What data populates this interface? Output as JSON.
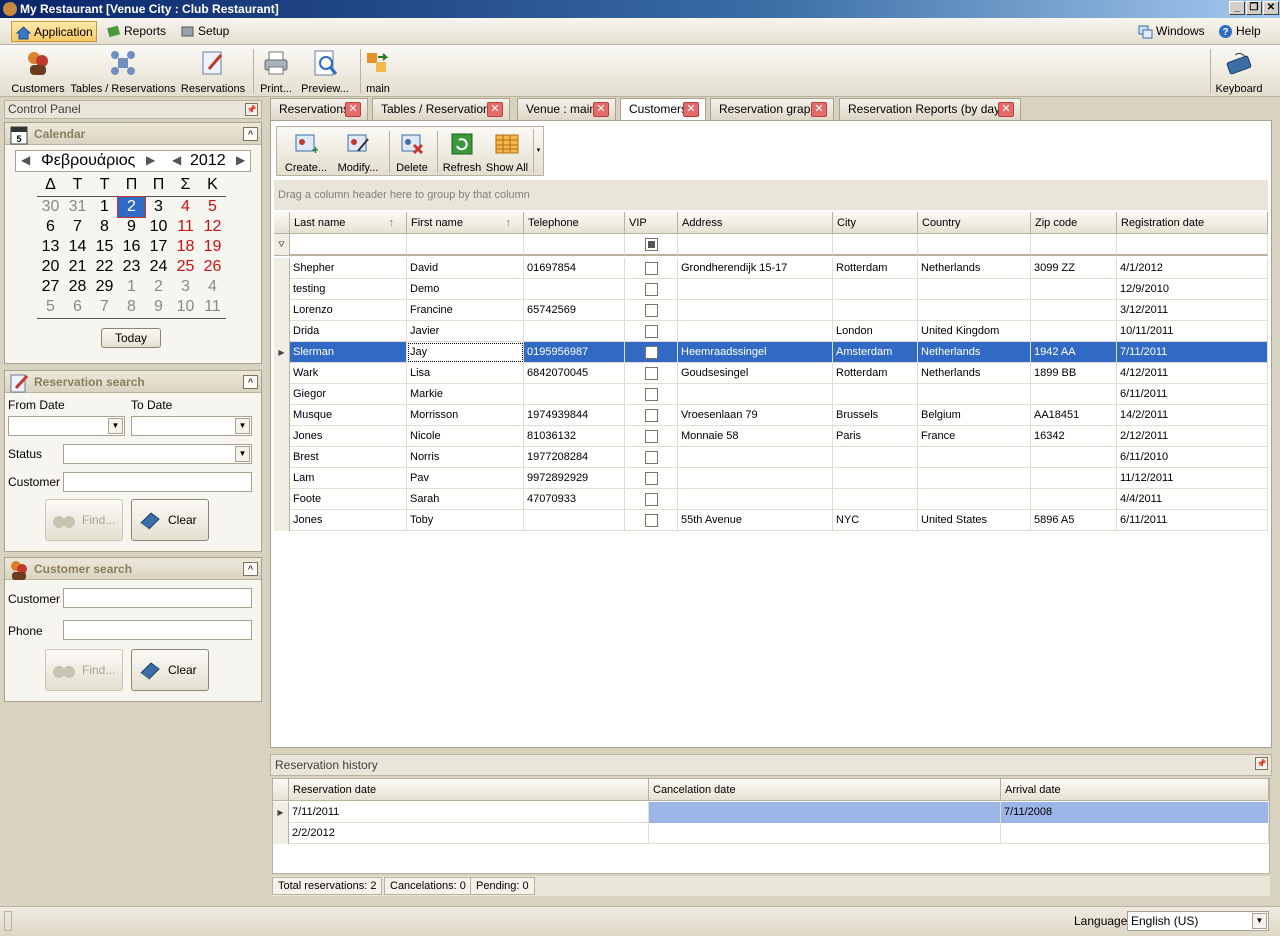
{
  "window": {
    "title": "My Restaurant [Venue City : Club Restaurant]"
  },
  "menu": {
    "left": [
      {
        "label": "Application",
        "icon": "home-icon"
      },
      {
        "label": "Reports",
        "icon": "reports-icon"
      },
      {
        "label": "Setup",
        "icon": "setup-icon"
      }
    ],
    "right": [
      {
        "label": "Windows",
        "icon": "windows-icon"
      },
      {
        "label": "Help",
        "icon": "help-icon"
      }
    ]
  },
  "toolbar": {
    "buttons": [
      "Customers",
      "Tables / Reservations",
      "Reservations",
      "Print...",
      "Preview...",
      "main"
    ],
    "keyboard": "Keyboard"
  },
  "control_panel": {
    "title": "Control Panel"
  },
  "calendar": {
    "title": "Calendar",
    "month": "Φεβρουάριος",
    "year": "2012",
    "weekdays": [
      "Δ",
      "Τ",
      "Τ",
      "Π",
      "Π",
      "Σ",
      "Κ"
    ],
    "weeks": [
      [
        "30",
        "31",
        "1",
        "2",
        "3",
        "4",
        "5"
      ],
      [
        "6",
        "7",
        "8",
        "9",
        "10",
        "11",
        "12"
      ],
      [
        "13",
        "14",
        "15",
        "16",
        "17",
        "18",
        "19"
      ],
      [
        "20",
        "21",
        "22",
        "23",
        "24",
        "25",
        "26"
      ],
      [
        "27",
        "28",
        "29",
        "1",
        "2",
        "3",
        "4"
      ],
      [
        "5",
        "6",
        "7",
        "8",
        "9",
        "10",
        "11"
      ]
    ],
    "selected_day": "2",
    "today_label": "Today",
    "colors": {
      "other_month": "#8a8a8a",
      "weekend": "#cc1111",
      "selected_bg": "#316ac5"
    }
  },
  "reservation_search": {
    "title": "Reservation search",
    "from_date_label": "From Date",
    "to_date_label": "To Date",
    "status_label": "Status",
    "customer_label": "Customer",
    "find_label": "Find...",
    "clear_label": "Clear"
  },
  "customer_search": {
    "title": "Customer search",
    "customer_label": "Customer",
    "phone_label": "Phone",
    "find_label": "Find...",
    "clear_label": "Clear"
  },
  "tabs": [
    {
      "label": "Reservations",
      "active": false
    },
    {
      "label": "Tables / Reservations",
      "active": false
    },
    {
      "label": "Venue : main",
      "active": false
    },
    {
      "label": "Customers",
      "active": true
    },
    {
      "label": "Reservation graph",
      "active": false
    },
    {
      "label": "Reservation Reports (by day)",
      "active": false
    }
  ],
  "grid_toolbar": [
    "Create...",
    "Modify...",
    "Delete",
    "Refresh",
    "Show All"
  ],
  "group_hint": "Drag a column header here to group by that column",
  "customers": {
    "columns": [
      "Last name",
      "First name",
      "Telephone",
      "VIP",
      "Address",
      "City",
      "Country",
      "Zip code",
      "Registration date"
    ],
    "rows": [
      [
        "Shepher",
        "David",
        "01697854",
        "",
        "Grondherendijk 15-17",
        "Rotterdam",
        "Netherlands",
        "3099 ZZ",
        "4/1/2012"
      ],
      [
        "testing",
        "Demo",
        "",
        "",
        "",
        "",
        "",
        "",
        "12/9/2010"
      ],
      [
        "Lorenzo",
        "Francine",
        "65742569",
        "",
        "",
        "",
        "",
        "",
        "3/12/2011"
      ],
      [
        "Drida",
        "Javier",
        "",
        "",
        "",
        "London",
        "United Kingdom",
        "",
        "10/11/2011"
      ],
      [
        "Slerman",
        "Jay",
        "0195956987",
        "",
        "Heemraadssingel",
        "Amsterdam",
        "Netherlands",
        "1942 AA",
        "7/11/2011"
      ],
      [
        "Wark",
        "Lisa",
        "6842070045",
        "",
        "Goudsesingel",
        "Rotterdam",
        "Netherlands",
        "1899 BB",
        "4/12/2011"
      ],
      [
        "Giegor",
        "Markie",
        "",
        "",
        "",
        "",
        "",
        "",
        "6/11/2011"
      ],
      [
        "Musque",
        "Morrisson",
        "1974939844",
        "",
        "Vroesenlaan  79",
        "Brussels",
        "Belgium",
        "AA18451",
        "14/2/2011"
      ],
      [
        "Jones",
        "Nicole",
        "81036132",
        "",
        "Monnaie 58",
        "Paris",
        "France",
        "16342",
        "2/12/2011"
      ],
      [
        "Brest",
        "Norris",
        "1977208284",
        "",
        "",
        "",
        "",
        "",
        "6/11/2010"
      ],
      [
        "Lam",
        "Pav",
        "9972892929",
        "",
        "",
        "",
        "",
        "",
        "11/12/2011"
      ],
      [
        "Foote",
        "Sarah",
        "47070933",
        "",
        "",
        "",
        "",
        "",
        "4/4/2011"
      ],
      [
        "Jones",
        "Toby",
        "",
        "",
        "55th Avenue",
        "NYC",
        "United States",
        "5896 A5",
        "6/11/2011"
      ]
    ],
    "selected_row": 4
  },
  "reservation_history": {
    "title": "Reservation history",
    "columns": [
      "Reservation date",
      "Cancelation date",
      "Arrival date"
    ],
    "rows": [
      [
        "7/11/2011",
        "",
        "7/11/2008"
      ],
      [
        "2/2/2012",
        "",
        ""
      ]
    ],
    "status": [
      "Total reservations: 2",
      "Cancelations: 0",
      "Pending: 0"
    ]
  },
  "statusbar": {
    "language_label": "Language",
    "language_value": "English (US)"
  }
}
